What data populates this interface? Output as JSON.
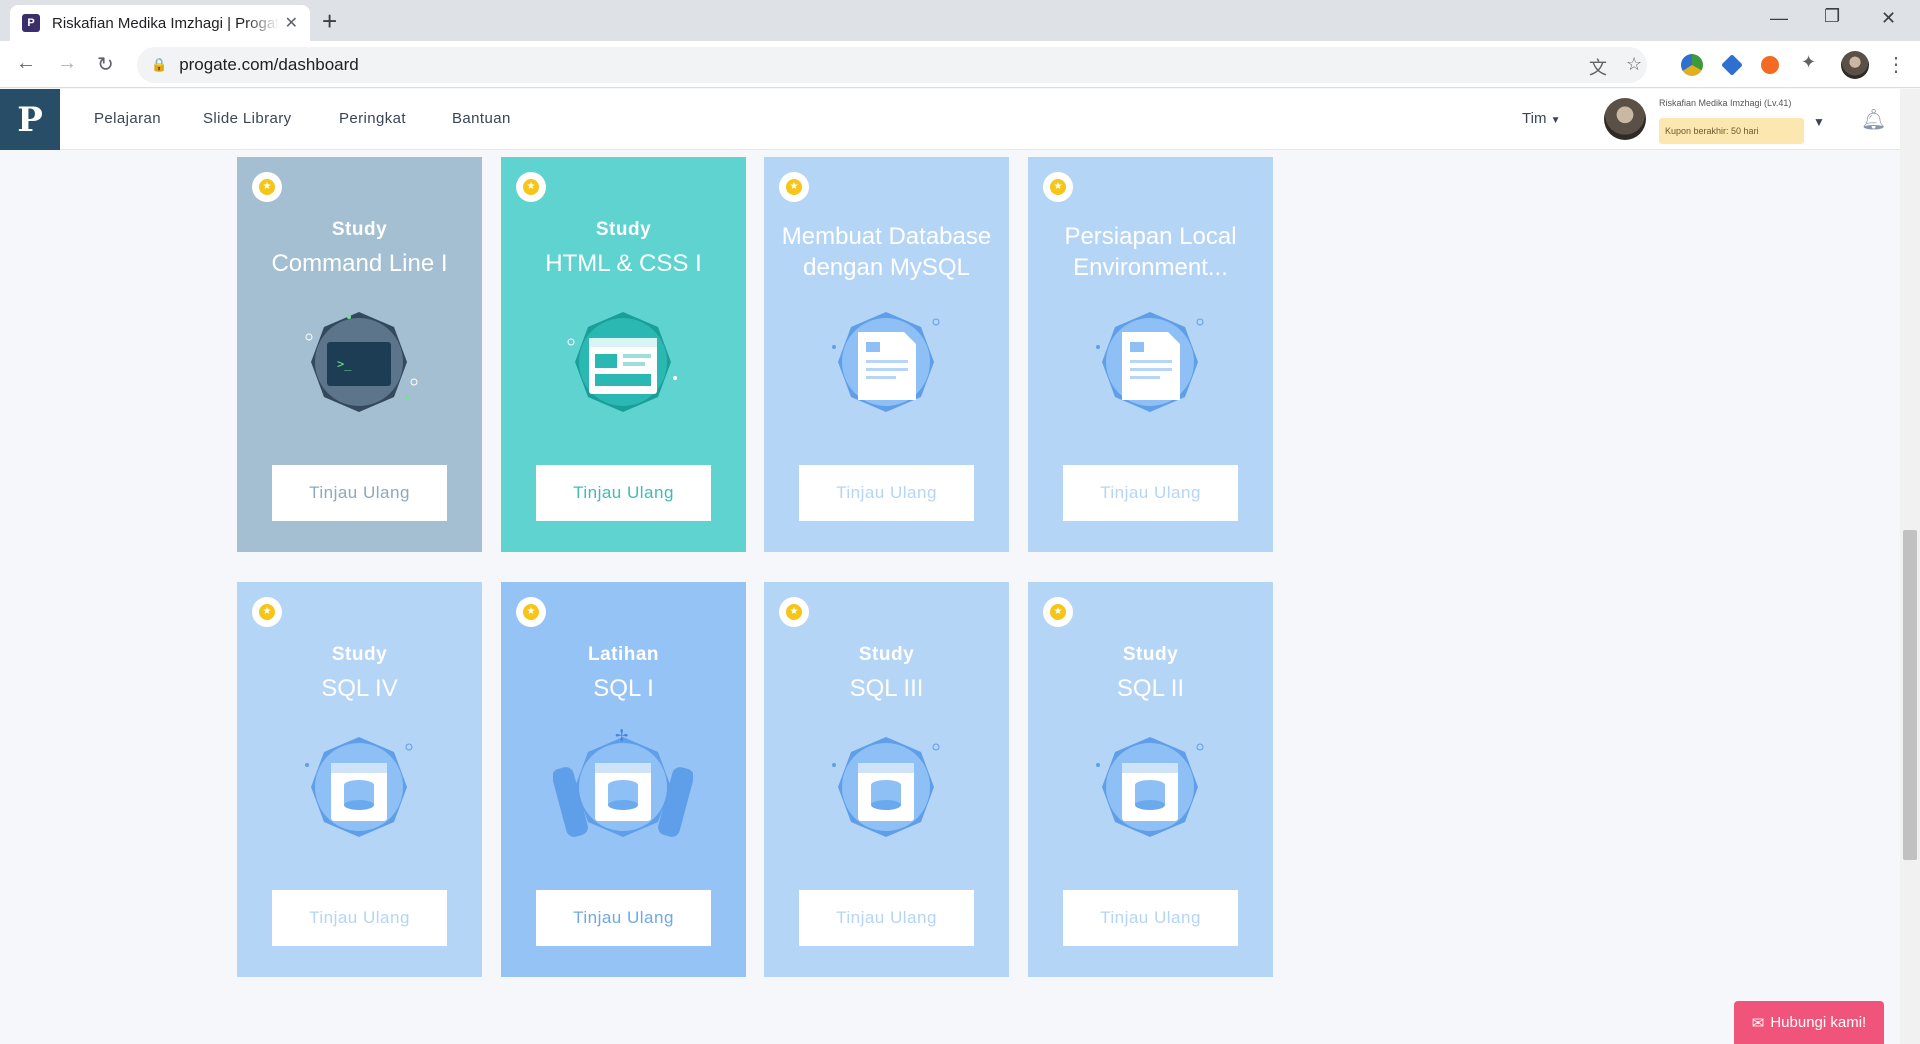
{
  "browser": {
    "tab_title": "Riskafian Medika Imzhagi | Progate",
    "tab_favicon": "P",
    "url": "progate.com/dashboard"
  },
  "site": {
    "logo_letter": "P",
    "nav": [
      "Pelajaran",
      "Slide Library",
      "Peringkat",
      "Bantuan"
    ],
    "team_label": "Tim",
    "user_name": "Riskafian Medika Imzhagi (Lv.41)",
    "coupon": "Kupon berakhir: 50 hari"
  },
  "colors": {
    "grey_card": "#a3bfd1",
    "teal_card": "#5ed3cf",
    "light_blue_card": "#b5d5f6",
    "mid_blue_card": "#96c3f6",
    "accent_pink": "#f0547a"
  },
  "cards": [
    {
      "type": "Study",
      "name": "Command Line  I",
      "button": "Tinjau Ulang",
      "icon": "terminal-badge-icon"
    },
    {
      "type": "Study",
      "name": "HTML & CSS I",
      "button": "Tinjau Ulang",
      "icon": "webpage-badge-icon"
    },
    {
      "type": "",
      "name": "Membuat Database dengan MySQL",
      "button": "Tinjau Ulang",
      "icon": "document-badge-icon"
    },
    {
      "type": "",
      "name": "Persiapan Local Environment...",
      "button": "Tinjau Ulang",
      "icon": "document-badge-icon"
    },
    {
      "type": "Study",
      "name": "SQL IV",
      "button": "Tinjau Ulang",
      "icon": "database-badge-icon"
    },
    {
      "type": "Latihan",
      "name": "SQL I",
      "button": "Tinjau Ulang",
      "icon": "database-scroll-badge-icon"
    },
    {
      "type": "Study",
      "name": "SQL III",
      "button": "Tinjau Ulang",
      "icon": "database-badge-icon"
    },
    {
      "type": "Study",
      "name": "SQL II",
      "button": "Tinjau Ulang",
      "icon": "database-badge-icon"
    }
  ],
  "contact_button": "Hubungi kami!"
}
